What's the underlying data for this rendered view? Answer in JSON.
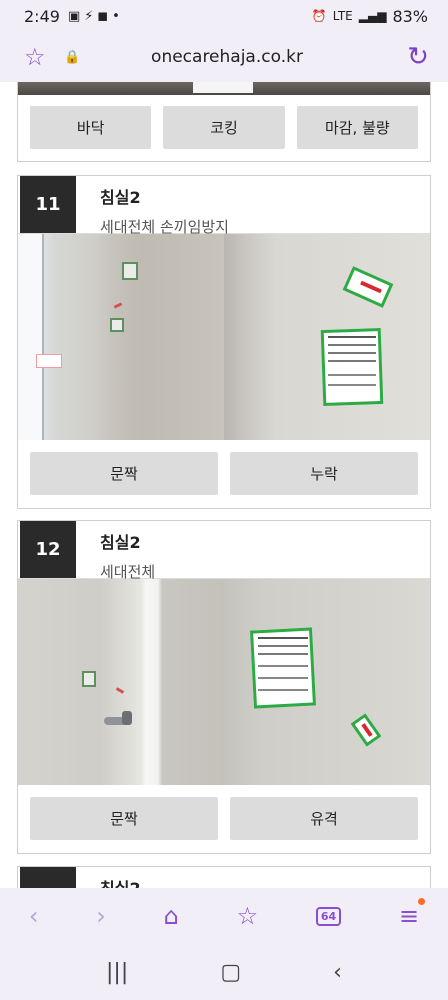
{
  "status_bar": {
    "time": "2:49",
    "network": "LTE",
    "battery": "83%"
  },
  "address_bar": {
    "url": "onecarehaja.co.kr"
  },
  "top_card": {
    "buttons": [
      "바닥",
      "코킹",
      "마감, 불량"
    ]
  },
  "cards": [
    {
      "number": "11",
      "room": "침실2",
      "description": "세대전체 손끼임방지",
      "buttons": [
        "문짝",
        "누락"
      ]
    },
    {
      "number": "12",
      "room": "침실2",
      "description": "세대전체",
      "buttons": [
        "문짝",
        "유격"
      ]
    },
    {
      "room": "침실2"
    }
  ],
  "bottom_nav": {
    "tab_count": "64"
  }
}
